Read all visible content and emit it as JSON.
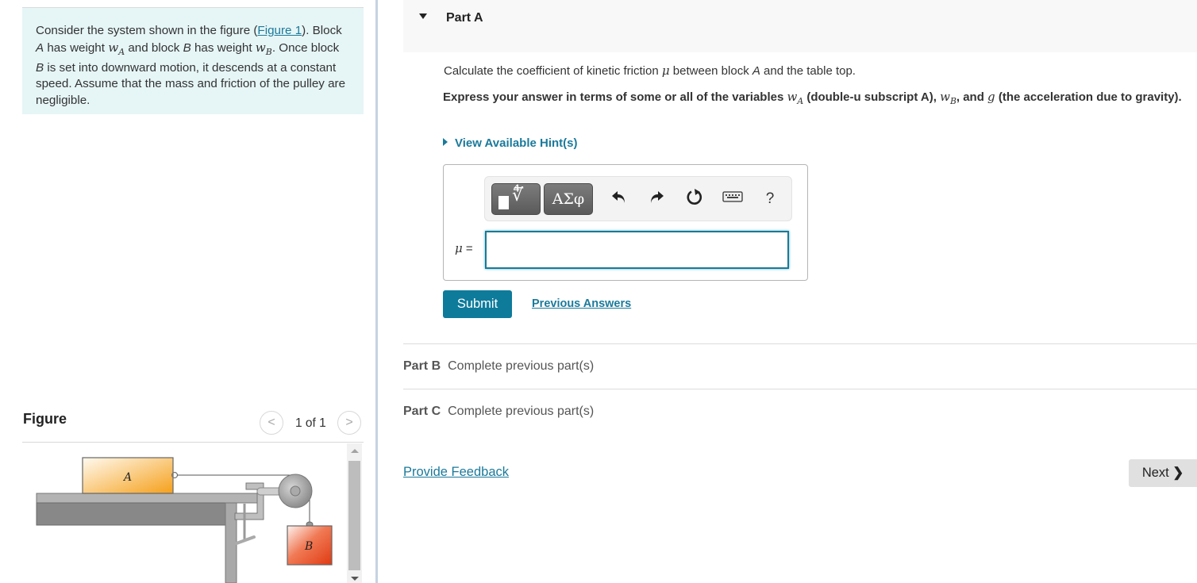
{
  "intro": {
    "text_1": "Consider the system shown in the figure (",
    "figure_link": "Figure 1",
    "text_2": "). Block ",
    "block_a": "A",
    "text_3": " has weight ",
    "wa_base": "w",
    "wa_sub": "A",
    "text_4": " and block ",
    "block_b": "B",
    "text_5": " has weight ",
    "wb_base": "w",
    "wb_sub": "B",
    "text_6": ". Once block ",
    "text_7": " is set into downward motion, it descends at a constant speed. Assume that the mass and friction of the pulley are negligible."
  },
  "figure": {
    "title": "Figure",
    "pager_text": "1 of 1",
    "prev_icon": "chevron-left-icon",
    "next_icon": "chevron-right-icon",
    "block_a_label": "A",
    "block_b_label": "B",
    "colors": {
      "block_a": "#f5a623",
      "block_b": "#e8502a",
      "table": "#8a8a8a"
    }
  },
  "part_a": {
    "title": "Part A",
    "question_1": "Calculate the coefficient of kinetic friction ",
    "mu": "μ",
    "question_2": " between block ",
    "question_block": "A",
    "question_3": " and the table top.",
    "instruction_1": "Express your answer in terms of some or all of the variables ",
    "instr_wa_base": "w",
    "instr_wa_sub": "A",
    "instruction_2": " (double-u subscript A), ",
    "instr_wb_base": "w",
    "instr_wb_sub": "B",
    "instruction_3": ", and ",
    "instr_g": "g",
    "instruction_4": " (the acceleration due to gravity).",
    "hints_label": "View Available Hint(s)",
    "toolbar": {
      "templates_icon": "templates-radical-icon",
      "greek_label": "ΑΣφ",
      "undo_icon": "undo-icon",
      "redo_icon": "redo-icon",
      "reset_icon": "reset-icon",
      "keyboard_icon": "keyboard-icon",
      "help_label": "?"
    },
    "answer_label": "μ",
    "answer_eq": " =",
    "answer_value": "",
    "submit_label": "Submit",
    "previous_answers_label": "Previous Answers"
  },
  "parts": [
    {
      "label": "Part B",
      "status": "Complete previous part(s)"
    },
    {
      "label": "Part C",
      "status": "Complete previous part(s)"
    }
  ],
  "footer": {
    "feedback_label": "Provide Feedback",
    "next_label": "Next",
    "next_icon": "❯"
  },
  "colors": {
    "accent": "#0e7b9b",
    "link": "#1b7a9b",
    "intro_bg": "#e6f5f6"
  }
}
